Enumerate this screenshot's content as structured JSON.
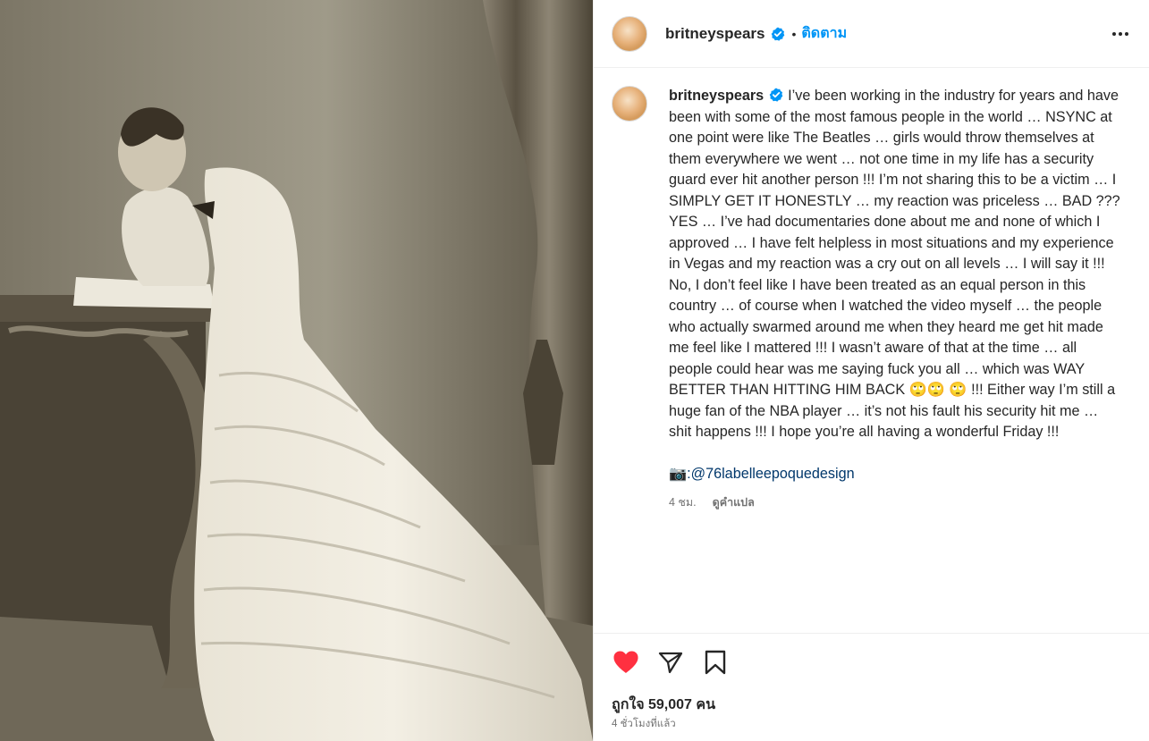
{
  "post": {
    "username": "britneyspears",
    "follow_label": "ติดตาม",
    "separator": "•",
    "caption": "I’ve been working in the industry for years and have been with some of the most famous people in the world … NSYNC at one point were like The Beatles … girls would throw themselves at them everywhere we went … not one time in my life has a security guard ever hit another person !!! I’m not sharing this to be a victim … I SIMPLY GET IT HONESTLY … my reaction was priceless … BAD ??? YES … I’ve had documentaries done about me and none of which I approved … I have felt helpless in most situations and my experience in Vegas and my reaction was a cry out on all levels … I will say it !!! No, I don’t feel like I have been treated as an equal person in this country … of course when I watched the video myself … the people who actually swarmed around me when they heard me get hit made me feel like I mattered !!! I wasn’t aware of that at the time … all people could hear was me saying fuck you all … which was WAY BETTER THAN HITTING HIM BACK 🙄🙄 🙄 !!! Either way I’m still a huge fan of the NBA player … it’s not his fault his security hit me … shit happens !!! I hope you’re all having a wonderful Friday !!!",
    "credit": "📷:@76labelleepoquedesign",
    "caption_time": "4 ชม.",
    "translate_label": "ดูคำแปล",
    "likes_label": "ถูกใจ 59,007 คน",
    "post_time": "4 ชั่วโมงที่แล้ว"
  },
  "icons": {
    "verified": "verified-badge-icon",
    "more": "more-options-icon",
    "like": "heart-filled-icon",
    "share": "share-icon",
    "save": "bookmark-icon"
  },
  "colors": {
    "accent": "#0095f6",
    "like": "#ff3040",
    "verified": "#0095f6",
    "link": "#00376b",
    "muted": "#737373",
    "text": "#262626"
  }
}
